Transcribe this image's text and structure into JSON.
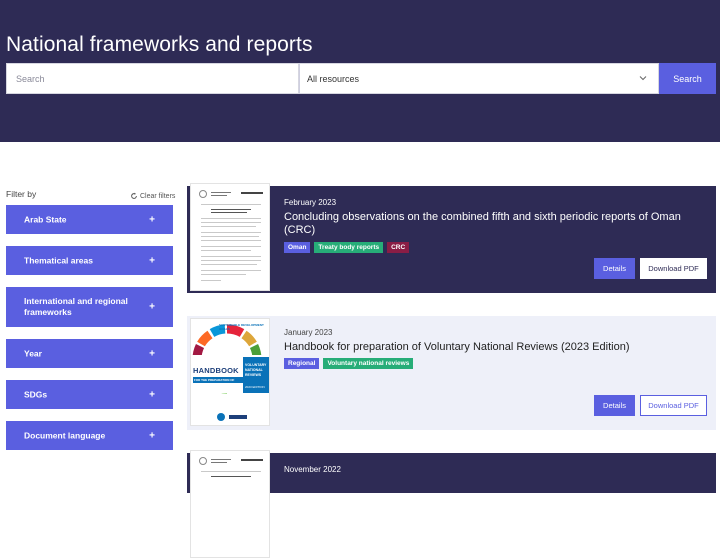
{
  "page": {
    "title": "National frameworks and reports"
  },
  "search": {
    "placeholder": "Search",
    "resource_select": "All resources",
    "button_label": "Search"
  },
  "filters": {
    "heading": "Filter by",
    "clear_label": "Clear filters",
    "items": [
      {
        "label": "Arab State"
      },
      {
        "label": "Thematical areas"
      },
      {
        "label": "International and regional frameworks"
      },
      {
        "label": "Year"
      },
      {
        "label": "SDGs"
      },
      {
        "label": "Document language"
      }
    ],
    "expand_glyph": "+"
  },
  "results": [
    {
      "date": "February 2023",
      "title": "Concluding observations on the combined fifth and sixth periodic reports of Oman (CRC)",
      "tags": [
        "Oman",
        "Treaty body reports",
        "CRC"
      ],
      "details_label": "Details",
      "pdf_label": "Download PDF"
    },
    {
      "date": "January 2023",
      "title": "Handbook for preparation of Voluntary National Reviews (2023 Edition)",
      "tags": [
        "Regional",
        "Voluntary national reviews"
      ],
      "details_label": "Details",
      "pdf_label": "Download PDF",
      "cover": {
        "top_text": "SUSTAINABLE DEVELOPMENT GOALS",
        "handbook": "HANDBOOK",
        "for_prep": "FOR THE PREPARATION OF",
        "side": [
          "VOLUNTARY",
          "NATIONAL",
          "REVIEWS"
        ],
        "edition": "2023 EDITION"
      }
    },
    {
      "date": "November 2022"
    }
  ],
  "colors": {
    "navy": "#2e2b55",
    "accent": "#5a5fe0",
    "green_tag": "#27ad78",
    "maroon_tag": "#8a1d45",
    "light_card": "#eef0f9"
  },
  "icons": {
    "dropdown": "chevron-down-icon",
    "clear": "refresh-icon",
    "expand": "plus-icon"
  }
}
